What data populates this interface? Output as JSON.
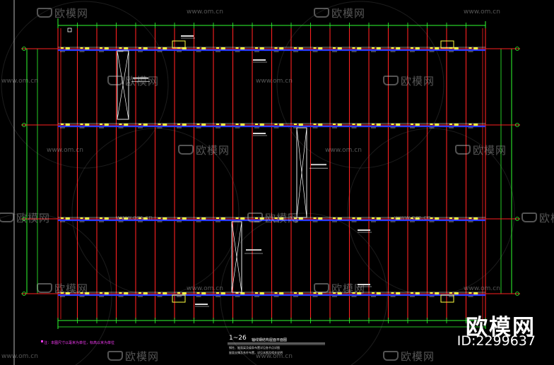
{
  "drawing": {
    "title_number": "1~26",
    "title_text": "轴线钢结构屋面平面图",
    "remarks": [
      "钢柱、屋面梁及檩条布置详见各节点详图",
      "屋面支撑及系杆布置，详见本图及相关说明"
    ],
    "note": "注：本图尺寸以毫米为单位，标高以米为单位",
    "bracing_note": "屋面水平支撑 ZC-1",
    "colors": {
      "background": "#000000",
      "grid_lines": "#ff2020",
      "dimension_lines": "#30ff30",
      "beams": "#2a3cff",
      "purlins": "#ffff40",
      "text": "#ffffff",
      "note": "#ff3cff"
    }
  },
  "watermark": {
    "brand": "欧模网",
    "url": "www.om.cn"
  },
  "branding": {
    "name": "欧模网",
    "id_label": "ID:2299637"
  }
}
